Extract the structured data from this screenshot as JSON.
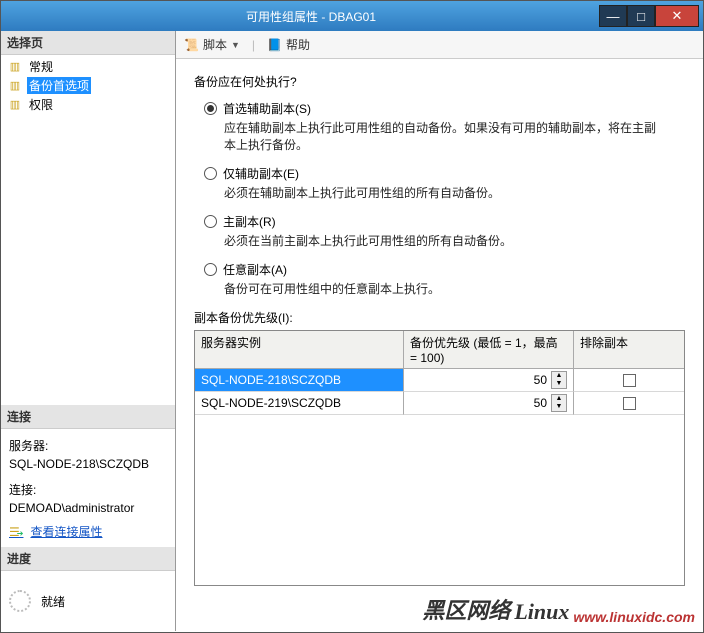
{
  "window": {
    "title": "可用性组属性 - DBAG01"
  },
  "left": {
    "select_header": "选择页",
    "nav": {
      "general": "常规",
      "backup_pref": "备份首选项",
      "permissions": "权限"
    },
    "conn_header": "连接",
    "server_label": "服务器:",
    "server_value": "SQL-NODE-218\\SCZQDB",
    "conn_label": "连接:",
    "conn_value": "DEMOAD\\administrator",
    "view_conn_props": "查看连接属性",
    "progress_header": "进度",
    "progress_status": "就绪"
  },
  "toolbar": {
    "script": "脚本",
    "help": "帮助"
  },
  "content": {
    "question": "备份应在何处执行?",
    "opt1_label": "首选辅助副本(S)",
    "opt1_desc": "应在辅助副本上执行此可用性组的自动备份。如果没有可用的辅助副本，将在主副本上执行备份。",
    "opt2_label": "仅辅助副本(E)",
    "opt2_desc": "必须在辅助副本上执行此可用性组的所有自动备份。",
    "opt3_label": "主副本(R)",
    "opt3_desc": "必须在当前主副本上执行此可用性组的所有自动备份。",
    "opt4_label": "任意副本(A)",
    "opt4_desc": "备份可在可用性组中的任意副本上执行。",
    "fieldset": "副本备份优先级(I):",
    "grid": {
      "col_server": "服务器实例",
      "col_priority": "备份优先级 (最低 = 1，最高 = 100)",
      "col_exclude": "排除副本",
      "rows": [
        {
          "server": "SQL-NODE-218\\SCZQDB",
          "priority": "50",
          "exclude": false,
          "selected": true
        },
        {
          "server": "SQL-NODE-219\\SCZQDB",
          "priority": "50",
          "exclude": false,
          "selected": false
        }
      ]
    }
  },
  "watermark": {
    "t1": "黑区网络",
    "t2": "Linux",
    "t3": "www.linuxidc.com"
  }
}
